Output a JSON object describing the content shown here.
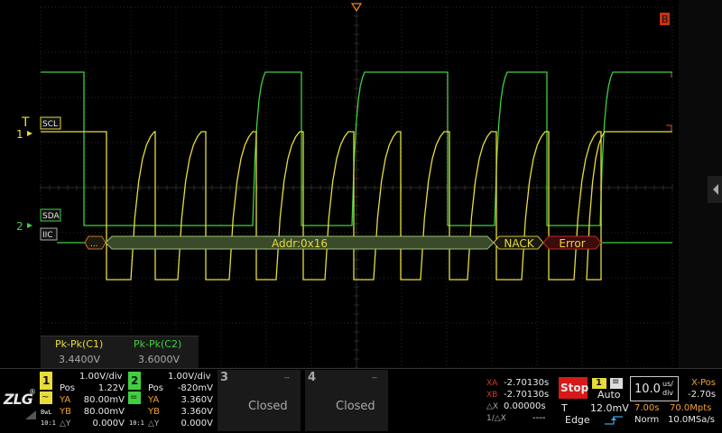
{
  "screen": {
    "background": "#000000",
    "grid_color": "#2a2a2a"
  },
  "colors": {
    "ch1": "#e8dc3c",
    "ch2": "#3fcf3f",
    "decode": "#3a4a2a",
    "error": "#d23a2a",
    "accent": "#e06010"
  },
  "trigger_marker": {
    "letter": "T"
  },
  "channel_markers": {
    "ch1": "1",
    "ch2": "2"
  },
  "labels": {
    "scl": "SCL",
    "sda": "SDA",
    "iic": "IIC"
  },
  "right_marker": {
    "letter": "B"
  },
  "decode": {
    "start": "...",
    "address": "Addr:0x16",
    "nack": "NACK",
    "error": "Error"
  },
  "measurements": [
    {
      "name": "Pk-Pk(C1)",
      "value": "3.4400V"
    },
    {
      "name": "Pk-Pk(C2)",
      "value": "3.6000V"
    }
  ],
  "channel1": {
    "number": "1",
    "scale": "1.00V/div",
    "pos_label": "Pos",
    "pos_value": "1.22V",
    "ya_label": "YA",
    "ya_value": "80.00mV",
    "yb_label": "YB",
    "yb_value": "80.00mV",
    "dy_label": "△Y",
    "dy_value": "0.000V",
    "bw_label": "BwL",
    "ratio_label": "10:1"
  },
  "channel2": {
    "number": "2",
    "scale": "1.00V/div",
    "pos_label": "Pos",
    "pos_value": "-820mV",
    "ya_label": "YA",
    "ya_value": "3.360V",
    "yb_label": "YB",
    "yb_value": "3.360V",
    "dy_label": "△Y",
    "dy_value": "0.000V",
    "ratio_label": "10:1"
  },
  "channel3": {
    "number": "3",
    "status": "Closed",
    "dashes": "--"
  },
  "channel4": {
    "number": "4",
    "status": "Closed",
    "dashes": "--"
  },
  "cursors": {
    "xa_label": "XA",
    "xa_value": "-2.70130s",
    "xb_label": "XB",
    "xb_value": "-2.70130s",
    "dx_label": "△X",
    "dx_value": "0.00000s",
    "inv_label": "1/△X",
    "inv_value": "----"
  },
  "trigger": {
    "run_state": "Stop",
    "source": "1",
    "mode": "Auto",
    "t_label": "T",
    "level": "12.0mV",
    "type": "Edge"
  },
  "timebase": {
    "scale": "10.0",
    "unit_top": "us/",
    "unit_bottom": "div",
    "xpos_label": "X-Pos",
    "xpos_value": "-2.70s",
    "time": "7.00s",
    "mem": "70.0Mpts",
    "acq_mode": "Norm",
    "sample_rate": "10.0MSa/s"
  },
  "logo": "ZLG"
}
